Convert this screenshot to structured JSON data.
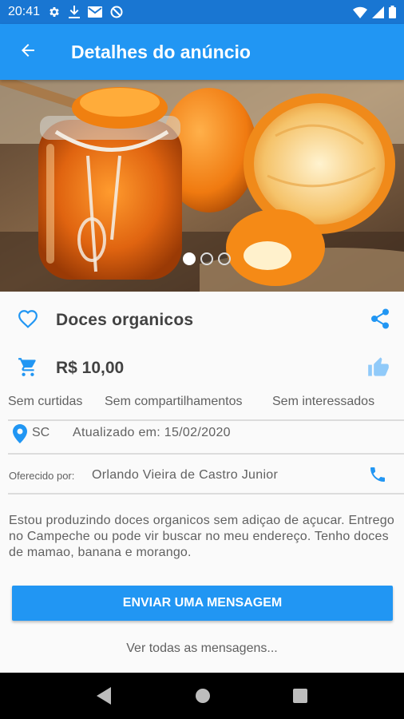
{
  "status_bar": {
    "time": "20:41",
    "left_icons": [
      "gear-icon",
      "download-icon",
      "mail-icon",
      "no-sim-blocked-icon"
    ],
    "right_icons": [
      "wifi-icon",
      "signal-icon",
      "battery-icon"
    ]
  },
  "app_bar": {
    "title": "Detalhes do anúncio",
    "back_icon": "arrow-left-icon",
    "color": "#2196f3"
  },
  "carousel": {
    "image_subject": "jar of orange marmalade with oranges",
    "page_count": 3,
    "active_page": 1
  },
  "ad": {
    "title": "Doces organicos",
    "price": "R$ 10,00",
    "stats": {
      "likes": "Sem curtidas",
      "shares": "Sem compartilhamentos",
      "interested": "Sem interessados"
    },
    "state": "SC",
    "updated": "Atualizado em: 15/02/2020",
    "offered_label": "Oferecido por:",
    "offered_by": "Orlando Vieira de Castro Junior",
    "description": "Estou produzindo doces organicos sem adiçao de açucar. Entrego no Campeche ou pode vir buscar no meu endereço. Tenho doces de mamao, banana e morango."
  },
  "actions": {
    "send_message": "ENVIAR UMA MENSAGEM",
    "see_all_messages": "Ver todas as mensagens..."
  },
  "colors": {
    "primary": "#2196f3",
    "primary_dark": "#1976d2",
    "like_inactive": "#90caf9"
  },
  "nav_bar": {
    "icons": [
      "back-triangle-icon",
      "home-circle-icon",
      "recents-square-icon"
    ]
  }
}
